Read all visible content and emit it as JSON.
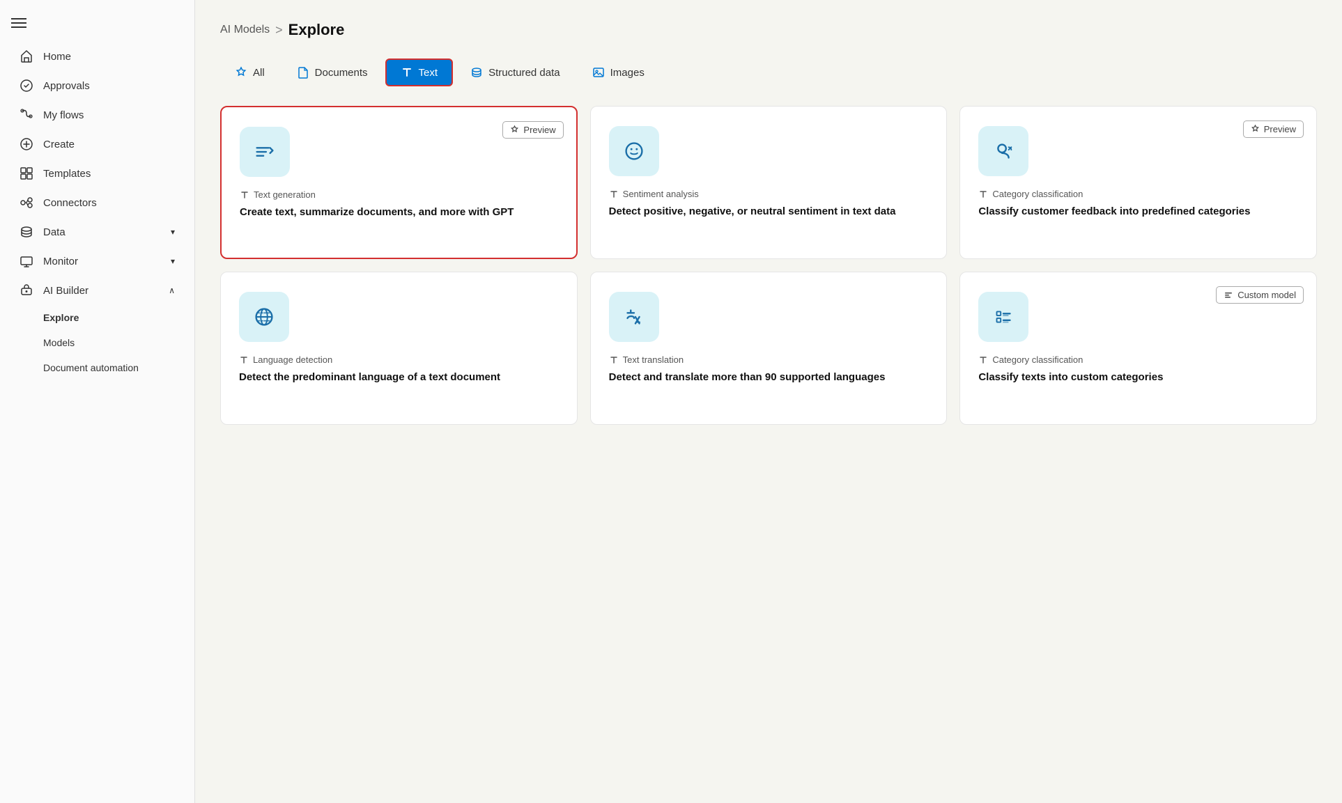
{
  "sidebar": {
    "items": [
      {
        "id": "home",
        "label": "Home",
        "icon": "home"
      },
      {
        "id": "approvals",
        "label": "Approvals",
        "icon": "approvals"
      },
      {
        "id": "myflows",
        "label": "My flows",
        "icon": "flows"
      },
      {
        "id": "create",
        "label": "Create",
        "icon": "create"
      },
      {
        "id": "templates",
        "label": "Templates",
        "icon": "templates"
      },
      {
        "id": "connectors",
        "label": "Connectors",
        "icon": "connectors"
      },
      {
        "id": "data",
        "label": "Data",
        "icon": "data",
        "hasChevron": true
      },
      {
        "id": "monitor",
        "label": "Monitor",
        "icon": "monitor",
        "hasChevron": true
      },
      {
        "id": "aibuilder",
        "label": "AI Builder",
        "icon": "aibuilder",
        "hasChevron": true,
        "expanded": true
      }
    ],
    "subItems": [
      {
        "id": "explore",
        "label": "Explore",
        "active": true
      },
      {
        "id": "models",
        "label": "Models"
      },
      {
        "id": "docauto",
        "label": "Document automation"
      }
    ]
  },
  "breadcrumb": {
    "parent": "AI Models",
    "separator": ">",
    "current": "Explore"
  },
  "tabs": [
    {
      "id": "all",
      "label": "All",
      "icon": "star",
      "active": false
    },
    {
      "id": "documents",
      "label": "Documents",
      "icon": "doc",
      "active": false
    },
    {
      "id": "text",
      "label": "Text",
      "icon": "text-t",
      "active": true,
      "highlighted": true
    },
    {
      "id": "structured",
      "label": "Structured data",
      "icon": "db",
      "active": false
    },
    {
      "id": "images",
      "label": "Images",
      "icon": "image",
      "active": false
    }
  ],
  "cards": [
    {
      "id": "textgen",
      "highlighted": true,
      "badge": "Preview",
      "type": "Text generation",
      "title": "Create text, summarize documents, and more with GPT",
      "icon": "textgen"
    },
    {
      "id": "sentiment",
      "highlighted": false,
      "badge": null,
      "type": "Sentiment analysis",
      "title": "Detect positive, negative, or neutral sentiment in text data",
      "icon": "sentiment"
    },
    {
      "id": "category1",
      "highlighted": false,
      "badge": "Preview",
      "type": "Category classification",
      "title": "Classify customer feedback into predefined categories",
      "icon": "category"
    },
    {
      "id": "langdetect",
      "highlighted": false,
      "badge": null,
      "type": "Language detection",
      "title": "Detect the predominant language of a text document",
      "icon": "globe"
    },
    {
      "id": "translation",
      "highlighted": false,
      "badge": null,
      "type": "Text translation",
      "title": "Detect and translate more than 90 supported languages",
      "icon": "translation"
    },
    {
      "id": "category2",
      "highlighted": false,
      "badge": "Custom model",
      "type": "Category classification",
      "title": "Classify texts into custom categories",
      "icon": "category2"
    }
  ]
}
